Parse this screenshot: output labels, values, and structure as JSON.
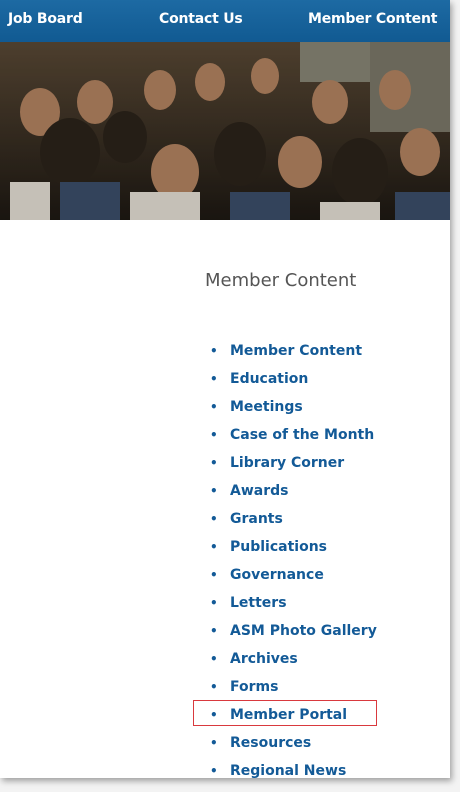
{
  "topnav": {
    "items": [
      {
        "label": "Job Board"
      },
      {
        "label": "Contact Us"
      },
      {
        "label": "Member Content"
      }
    ]
  },
  "section": {
    "title": "Member Content"
  },
  "menu": {
    "bullet": "•",
    "items": [
      {
        "label": "Member Content"
      },
      {
        "label": "Education"
      },
      {
        "label": "Meetings"
      },
      {
        "label": "Case of the Month"
      },
      {
        "label": "Library Corner"
      },
      {
        "label": "Awards"
      },
      {
        "label": "Grants"
      },
      {
        "label": "Publications"
      },
      {
        "label": "Governance"
      },
      {
        "label": "Letters"
      },
      {
        "label": "ASM Photo Gallery"
      },
      {
        "label": "Archives"
      },
      {
        "label": "Forms"
      },
      {
        "label": "Member Portal"
      },
      {
        "label": "Resources"
      },
      {
        "label": "Regional News"
      }
    ],
    "highlighted": "Member Portal"
  },
  "colors": {
    "nav_bg": "#1d6aa3",
    "link": "#135a97",
    "highlight_border": "#d9393e"
  }
}
